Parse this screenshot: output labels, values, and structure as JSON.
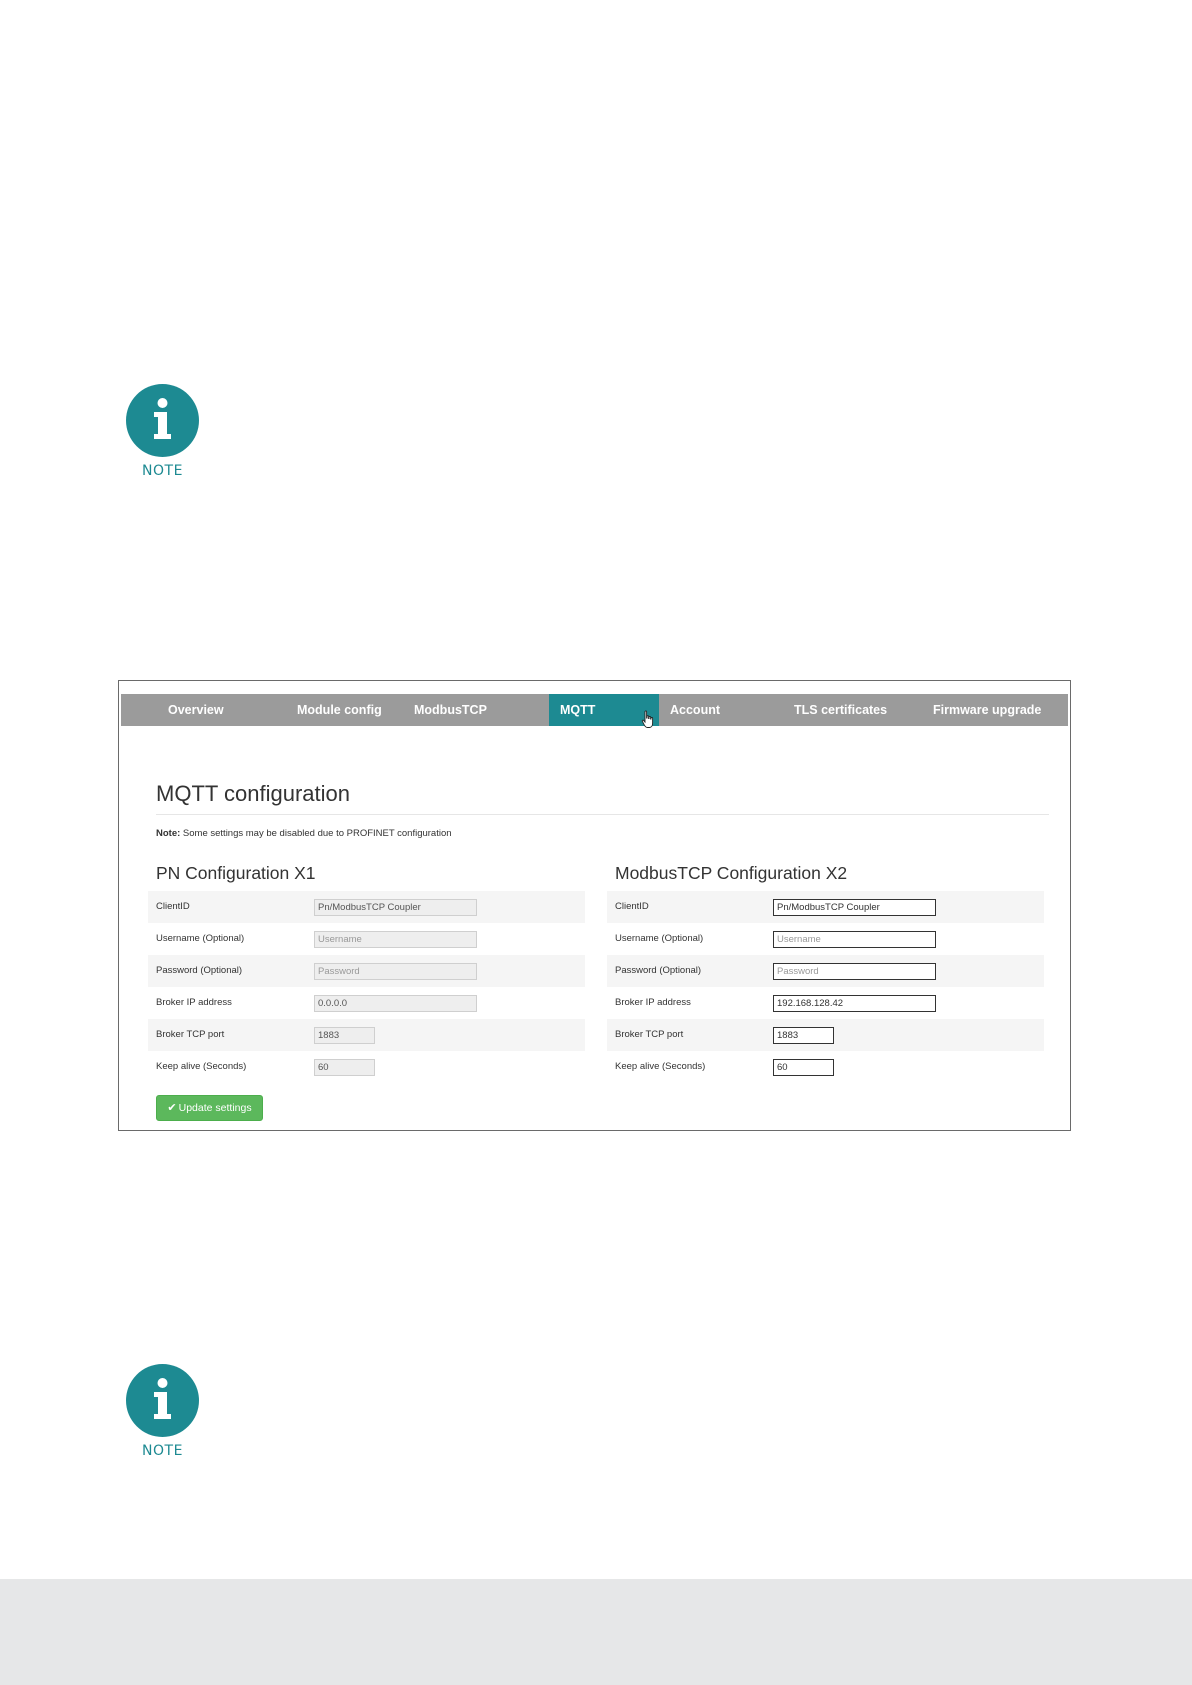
{
  "notes": [
    {
      "label": "NOTE"
    },
    {
      "label": "NOTE"
    }
  ],
  "nav": {
    "items": [
      {
        "label": "Overview",
        "active": false
      },
      {
        "label": "Module config",
        "active": false
      },
      {
        "label": "ModbusTCP",
        "active": false
      },
      {
        "label": "MQTT",
        "active": true
      },
      {
        "label": "Account",
        "active": false
      },
      {
        "label": "TLS certificates",
        "active": false
      },
      {
        "label": "Firmware upgrade",
        "active": false
      }
    ]
  },
  "main": {
    "title": "MQTT configuration",
    "note_prefix": "Note:",
    "note_text": " Some settings may be disabled due to PROFINET configuration",
    "update_button": "Update settings"
  },
  "pn": {
    "title": "PN Configuration X1",
    "rows": [
      {
        "label": "ClientID",
        "value": "Pn/ModbusTCP Coupler",
        "placeholder": ""
      },
      {
        "label": "Username (Optional)",
        "value": "",
        "placeholder": "Username"
      },
      {
        "label": "Password (Optional)",
        "value": "",
        "placeholder": "Password"
      },
      {
        "label": "Broker IP address",
        "value": "0.0.0.0",
        "placeholder": ""
      },
      {
        "label": "Broker TCP port",
        "value": "1883",
        "placeholder": ""
      },
      {
        "label": "Keep alive (Seconds)",
        "value": "60",
        "placeholder": ""
      }
    ]
  },
  "modbus": {
    "title": "ModbusTCP Configuration X2",
    "rows": [
      {
        "label": "ClientID",
        "value": "Pn/ModbusTCP Coupler",
        "placeholder": ""
      },
      {
        "label": "Username (Optional)",
        "value": "",
        "placeholder": "Username"
      },
      {
        "label": "Password (Optional)",
        "value": "",
        "placeholder": "Password"
      },
      {
        "label": "Broker IP address",
        "value": "192.168.128.42",
        "placeholder": ""
      },
      {
        "label": "Broker TCP port",
        "value": "1883",
        "placeholder": ""
      },
      {
        "label": "Keep alive (Seconds)",
        "value": "60",
        "placeholder": ""
      }
    ]
  },
  "colors": {
    "accent": "#1d8a92",
    "navbar": "#9b9b9b",
    "success": "#5cb85c",
    "footer": "#e6e7e8"
  }
}
